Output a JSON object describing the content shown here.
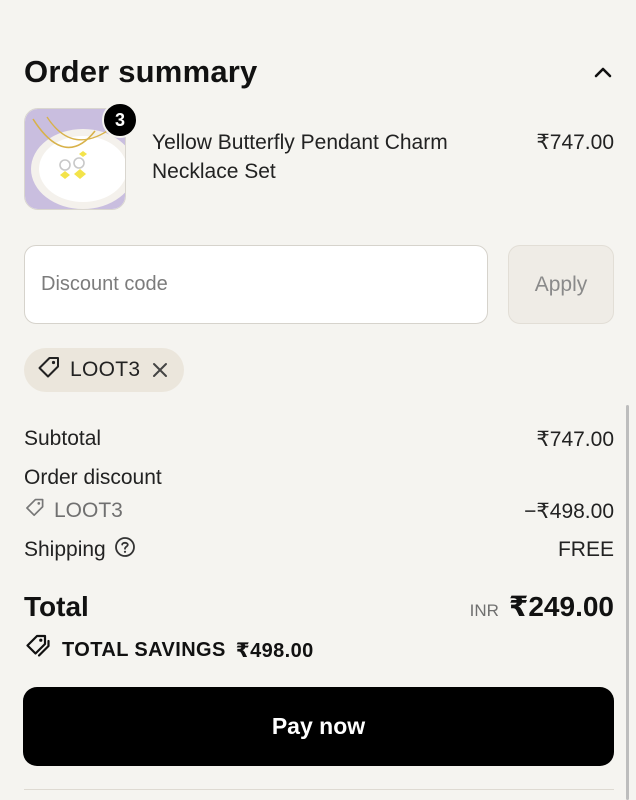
{
  "header": {
    "title": "Order summary",
    "collapse_icon": "chevron-up-icon"
  },
  "product": {
    "quantity_badge": "3",
    "name": "Yellow Butterfly Pendant Charm Necklace Set",
    "price": "₹747.00",
    "image_icon": "necklace-product-image"
  },
  "discount": {
    "placeholder": "Discount code",
    "value": "",
    "apply_label": "Apply",
    "applied_code": "LOOT3",
    "tag_icon": "tag-icon",
    "remove_icon": "close-icon"
  },
  "summary": {
    "subtotal_label": "Subtotal",
    "subtotal_value": "₹747.00",
    "order_discount_label": "Order discount",
    "discount_code": "LOOT3",
    "discount_value": "−₹498.00",
    "shipping_label": "Shipping",
    "shipping_value": "FREE",
    "help_icon": "question-circle-icon"
  },
  "total": {
    "label": "Total",
    "currency": "INR",
    "amount": "₹249.00"
  },
  "savings": {
    "label": "TOTAL SAVINGS",
    "amount": "₹498.00",
    "icon": "tags-icon"
  },
  "actions": {
    "pay_label": "Pay now"
  },
  "colors": {
    "background": "#f5f4f0",
    "primary": "#000000",
    "chip_bg": "#ebe6dc",
    "muted": "#707070"
  }
}
